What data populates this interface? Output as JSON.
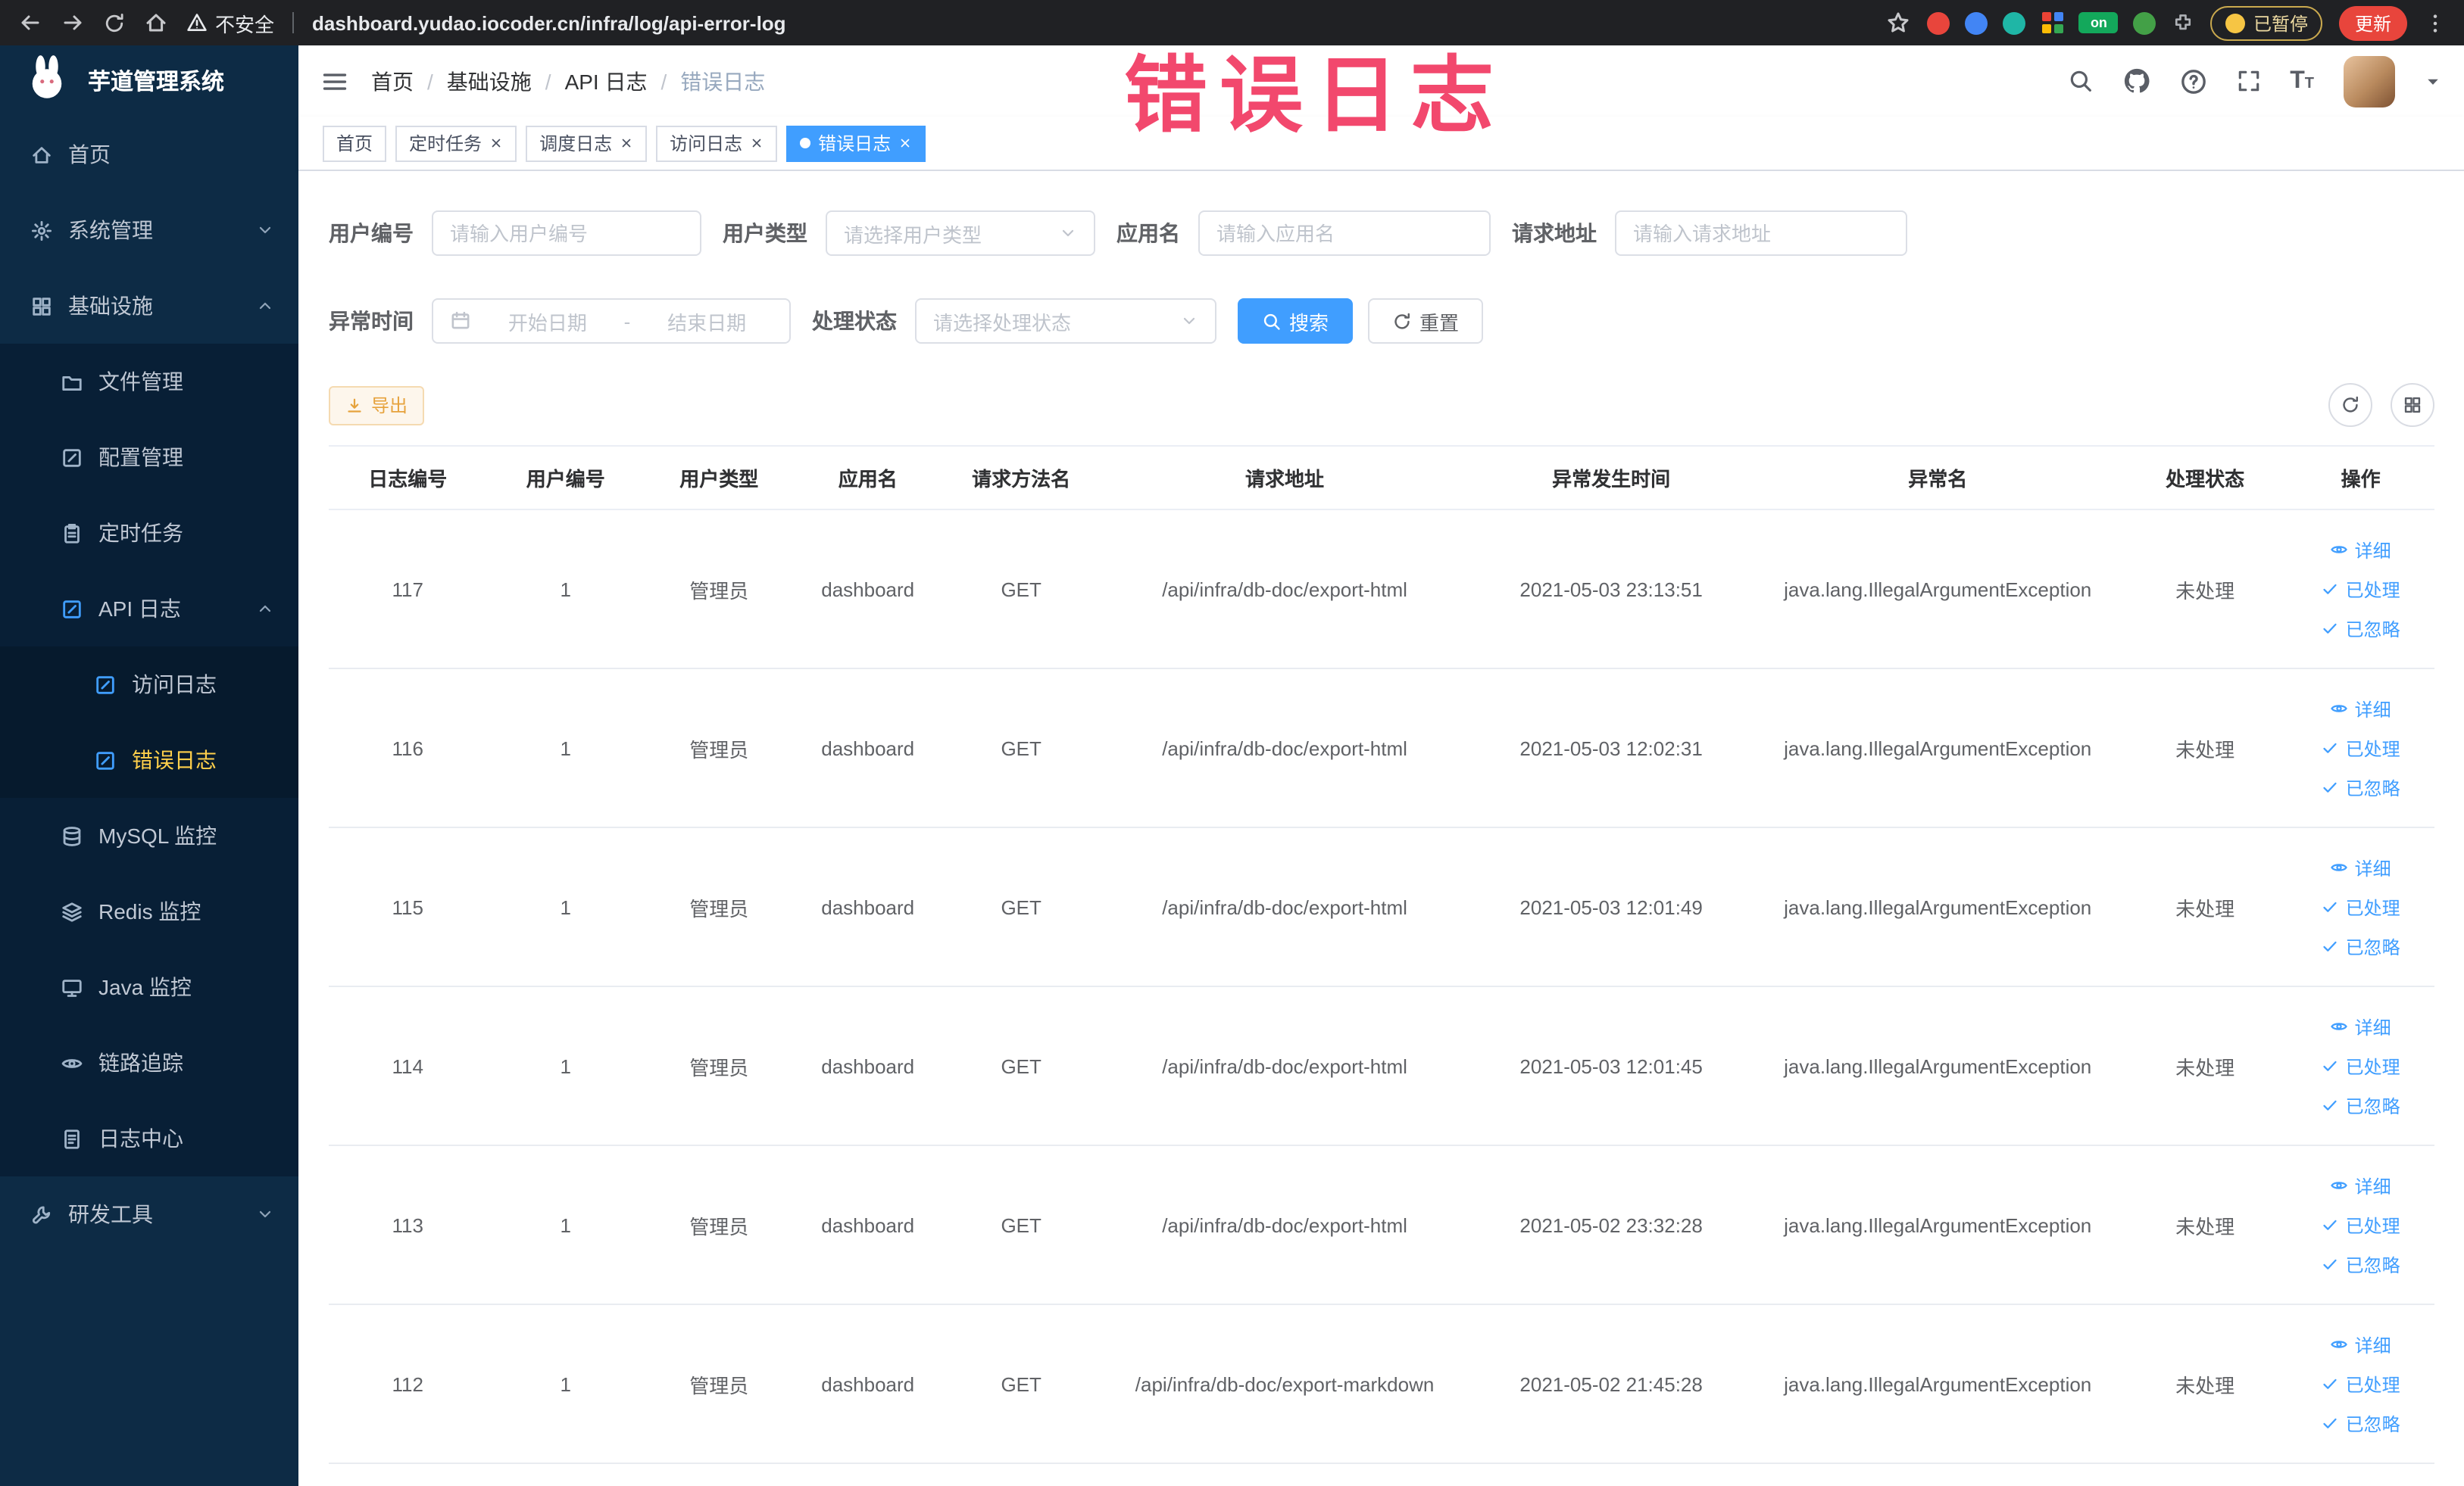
{
  "browser": {
    "security_label": "不安全",
    "url": "dashboard.yudao.iocoder.cn/infra/log/api-error-log",
    "paused_badge": "已暂停",
    "update_button": "更新",
    "extensions": [
      {
        "color": "#e8453c",
        "shape": "circle"
      },
      {
        "color": "#4285f4",
        "shape": "circle"
      },
      {
        "color": "#1fb6a6",
        "shape": "circle"
      },
      {
        "color": "#fbbc05",
        "shape": "grid"
      },
      {
        "color": "#13a85b",
        "shape": "badge",
        "label": "on"
      },
      {
        "color": "#43a047",
        "shape": "circle"
      },
      {
        "color": "#9aa0a6",
        "shape": "puzzle"
      }
    ]
  },
  "annotation": {
    "text": "错误日志",
    "color": "#f2486d"
  },
  "sidebar": {
    "logo_title": "芋道管理系统",
    "items": [
      {
        "label": "首页",
        "icon": "home",
        "level": 1
      },
      {
        "label": "系统管理",
        "icon": "gear",
        "level": 1,
        "arrow": "down"
      },
      {
        "label": "基础设施",
        "icon": "grid",
        "level": 1,
        "arrow": "up"
      },
      {
        "label": "文件管理",
        "icon": "folder",
        "level": 2
      },
      {
        "label": "配置管理",
        "icon": "edit",
        "level": 2
      },
      {
        "label": "定时任务",
        "icon": "clipboard",
        "level": 2
      },
      {
        "label": "API 日志",
        "icon": "edit",
        "level": 2,
        "arrow": "up",
        "accent": true
      },
      {
        "label": "访问日志",
        "icon": "edit",
        "level": 3,
        "accent": true
      },
      {
        "label": "错误日志",
        "icon": "edit",
        "level": 3,
        "accent": true,
        "active": true
      },
      {
        "label": "MySQL 监控",
        "icon": "db",
        "level": 2
      },
      {
        "label": "Redis 监控",
        "icon": "layers",
        "level": 2
      },
      {
        "label": "Java 监控",
        "icon": "monitor",
        "level": 2
      },
      {
        "label": "链路追踪",
        "icon": "eye",
        "level": 2
      },
      {
        "label": "日志中心",
        "icon": "doc",
        "level": 2
      },
      {
        "label": "研发工具",
        "icon": "wrench",
        "level": 1,
        "arrow": "down"
      }
    ]
  },
  "header": {
    "breadcrumb": [
      "首页",
      "基础设施",
      "API 日志",
      "错误日志"
    ]
  },
  "tabs": [
    {
      "label": "首页",
      "closable": false,
      "active": false
    },
    {
      "label": "定时任务",
      "closable": true,
      "active": false
    },
    {
      "label": "调度日志",
      "closable": true,
      "active": false
    },
    {
      "label": "访问日志",
      "closable": true,
      "active": false
    },
    {
      "label": "错误日志",
      "closable": true,
      "active": true
    }
  ],
  "filters": {
    "user_id": {
      "label": "用户编号",
      "placeholder": "请输入用户编号"
    },
    "user_type": {
      "label": "用户类型",
      "placeholder": "请选择用户类型"
    },
    "app_name": {
      "label": "应用名",
      "placeholder": "请输入应用名"
    },
    "request_url": {
      "label": "请求地址",
      "placeholder": "请输入请求地址"
    },
    "exception_time": {
      "label": "异常时间",
      "start_placeholder": "开始日期",
      "separator": "-",
      "end_placeholder": "结束日期"
    },
    "process_status": {
      "label": "处理状态",
      "placeholder": "请选择处理状态"
    },
    "search_button": "搜索",
    "reset_button": "重置"
  },
  "toolbar": {
    "export_button": "导出"
  },
  "table": {
    "columns": [
      "日志编号",
      "用户编号",
      "用户类型",
      "应用名",
      "请求方法名",
      "请求地址",
      "异常发生时间",
      "异常名",
      "处理状态",
      "操作"
    ],
    "actions": [
      "详细",
      "已处理",
      "已忽略"
    ],
    "rows": [
      {
        "id": "117",
        "user_id": "1",
        "user_type": "管理员",
        "app": "dashboard",
        "method": "GET",
        "url": "/api/infra/db-doc/export-html",
        "time": "2021-05-03 23:13:51",
        "exception": "java.lang.IllegalArgumentException",
        "status": "未处理"
      },
      {
        "id": "116",
        "user_id": "1",
        "user_type": "管理员",
        "app": "dashboard",
        "method": "GET",
        "url": "/api/infra/db-doc/export-html",
        "time": "2021-05-03 12:02:31",
        "exception": "java.lang.IllegalArgumentException",
        "status": "未处理"
      },
      {
        "id": "115",
        "user_id": "1",
        "user_type": "管理员",
        "app": "dashboard",
        "method": "GET",
        "url": "/api/infra/db-doc/export-html",
        "time": "2021-05-03 12:01:49",
        "exception": "java.lang.IllegalArgumentException",
        "status": "未处理"
      },
      {
        "id": "114",
        "user_id": "1",
        "user_type": "管理员",
        "app": "dashboard",
        "method": "GET",
        "url": "/api/infra/db-doc/export-html",
        "time": "2021-05-03 12:01:45",
        "exception": "java.lang.IllegalArgumentException",
        "status": "未处理"
      },
      {
        "id": "113",
        "user_id": "1",
        "user_type": "管理员",
        "app": "dashboard",
        "method": "GET",
        "url": "/api/infra/db-doc/export-html",
        "time": "2021-05-02 23:32:28",
        "exception": "java.lang.IllegalArgumentException",
        "status": "未处理"
      },
      {
        "id": "112",
        "user_id": "1",
        "user_type": "管理员",
        "app": "dashboard",
        "method": "GET",
        "url": "/api/infra/db-doc/export-markdown",
        "time": "2021-05-02 21:45:28",
        "exception": "java.lang.IllegalArgumentException",
        "status": "未处理"
      }
    ]
  }
}
